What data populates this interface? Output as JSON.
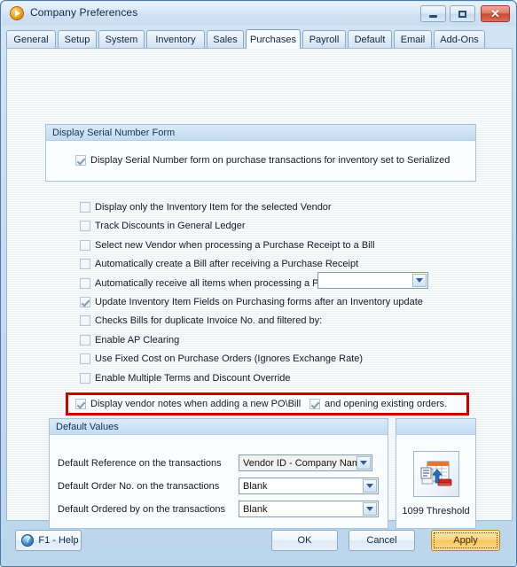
{
  "window": {
    "title": "Company Preferences",
    "title_icon": "play-circle-icon",
    "controls": {
      "minimize": "minimize-icon",
      "maximize": "maximize-icon",
      "close": "✕"
    }
  },
  "tabs": [
    {
      "label": "General",
      "active": false
    },
    {
      "label": "Setup",
      "active": false
    },
    {
      "label": "System",
      "active": false
    },
    {
      "label": "Inventory",
      "active": false
    },
    {
      "label": "Sales",
      "active": false
    },
    {
      "label": "Purchases",
      "active": true
    },
    {
      "label": "Payroll",
      "active": false
    },
    {
      "label": "Default",
      "active": false
    },
    {
      "label": "Email",
      "active": false
    },
    {
      "label": "Add-Ons",
      "active": false
    }
  ],
  "serial_group": {
    "title": "Display Serial Number Form",
    "checkbox": {
      "label": "Display Serial Number form on purchase transactions for inventory set to Serialized",
      "checked": true
    }
  },
  "options": [
    {
      "label": "Display only the Inventory Item for the selected Vendor",
      "checked": false
    },
    {
      "label": "Track Discounts in General Ledger",
      "checked": false
    },
    {
      "label": "Select new Vendor when processing a Purchase Receipt to a Bill",
      "checked": false
    },
    {
      "label": "Automatically create a Bill after receiving a Purchase Receipt",
      "checked": false
    },
    {
      "label": "Automatically receive all items when processing a PO to a Purchase Receipt",
      "checked": false
    },
    {
      "label": "Update Inventory Item Fields on Purchasing forms after an Inventory update",
      "checked": true
    },
    {
      "label": "Checks Bills for duplicate Invoice No. and filtered by:",
      "checked": false
    },
    {
      "label": "Enable AP Clearing",
      "checked": false
    },
    {
      "label": "Use Fixed Cost on Purchase Orders (Ignores Exchange Rate)",
      "checked": false
    },
    {
      "label": "Enable Multiple Terms and Discount Override",
      "checked": false
    }
  ],
  "duplicate_filter_combo": {
    "value": "",
    "placeholder": ""
  },
  "highlighted_row": {
    "border_color": "#cc0000",
    "checkbox_a": {
      "label": "Display vendor notes when adding a new PO\\Bill",
      "checked": true
    },
    "checkbox_b": {
      "label": "and opening existing orders.",
      "checked": true
    }
  },
  "defaults_group": {
    "title": "Default Values",
    "rows": [
      {
        "label": "Default Reference on the transactions",
        "value": "Vendor ID - Company Name"
      },
      {
        "label": "Default Order No. on the transactions",
        "value": "Blank"
      },
      {
        "label": "Default Ordered by on the transactions",
        "value": "Blank"
      }
    ]
  },
  "threshold_group": {
    "title": "",
    "icon": "1099-document-icon",
    "label": "1099 Threshold"
  },
  "footer": {
    "help_label": "F1 - Help",
    "help_icon": "?",
    "ok_label": "OK",
    "cancel_label": "Cancel",
    "apply_label": "Apply",
    "apply_color": "#f7c65e"
  }
}
